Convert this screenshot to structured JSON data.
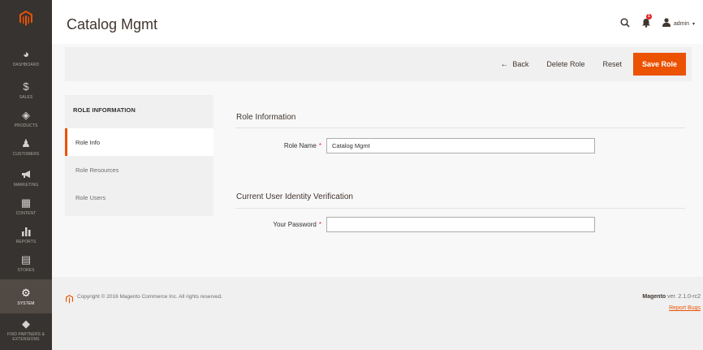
{
  "colors": {
    "accent": "#eb5202",
    "sidebar": "#373330",
    "sidebar_active": "#514943"
  },
  "sidebar": {
    "logo_icon": "magento-logo-icon",
    "items": [
      {
        "label": "DASHBOARD",
        "icon": "dashboard-icon",
        "glyph": "◕"
      },
      {
        "label": "SALES",
        "icon": "dollar-icon",
        "glyph": "$"
      },
      {
        "label": "PRODUCTS",
        "icon": "cube-icon",
        "glyph": "◈"
      },
      {
        "label": "CUSTOMERS",
        "icon": "person-icon",
        "glyph": "♟"
      },
      {
        "label": "MARKETING",
        "icon": "megaphone-icon",
        "glyph": "📢"
      },
      {
        "label": "CONTENT",
        "icon": "content-icon",
        "glyph": "▦"
      },
      {
        "label": "REPORTS",
        "icon": "bar-chart-icon",
        "glyph": "▮"
      },
      {
        "label": "STORES",
        "icon": "store-icon",
        "glyph": "▤"
      },
      {
        "label": "SYSTEM",
        "icon": "gear-icon",
        "glyph": "⚙"
      },
      {
        "label": "FIND PARTNERS & EXTENSIONS",
        "icon": "partners-icon",
        "glyph": "◆"
      }
    ]
  },
  "header": {
    "title": "Catalog Mgmt",
    "notification_count": "1",
    "admin_name": "admin"
  },
  "action_bar": {
    "back": "Back",
    "delete_role": "Delete Role",
    "reset": "Reset",
    "save_role": "Save Role"
  },
  "tabs": {
    "title": "ROLE INFORMATION",
    "items": [
      "Role Info",
      "Role Resources",
      "Role Users"
    ]
  },
  "role_info": {
    "section_title": "Role Information",
    "role_name_label": "Role Name",
    "role_name_value": "Catalog Mgmt"
  },
  "verification": {
    "section_title": "Current User Identity Verification",
    "password_label": "Your Password",
    "password_value": ""
  },
  "footer": {
    "copyright": "Copyright © 2016 Magento Commerce Inc. All rights reserved.",
    "brand": "Magento",
    "version": "ver. 2.1.0-rc2",
    "report_bugs": "Report Bugs"
  }
}
